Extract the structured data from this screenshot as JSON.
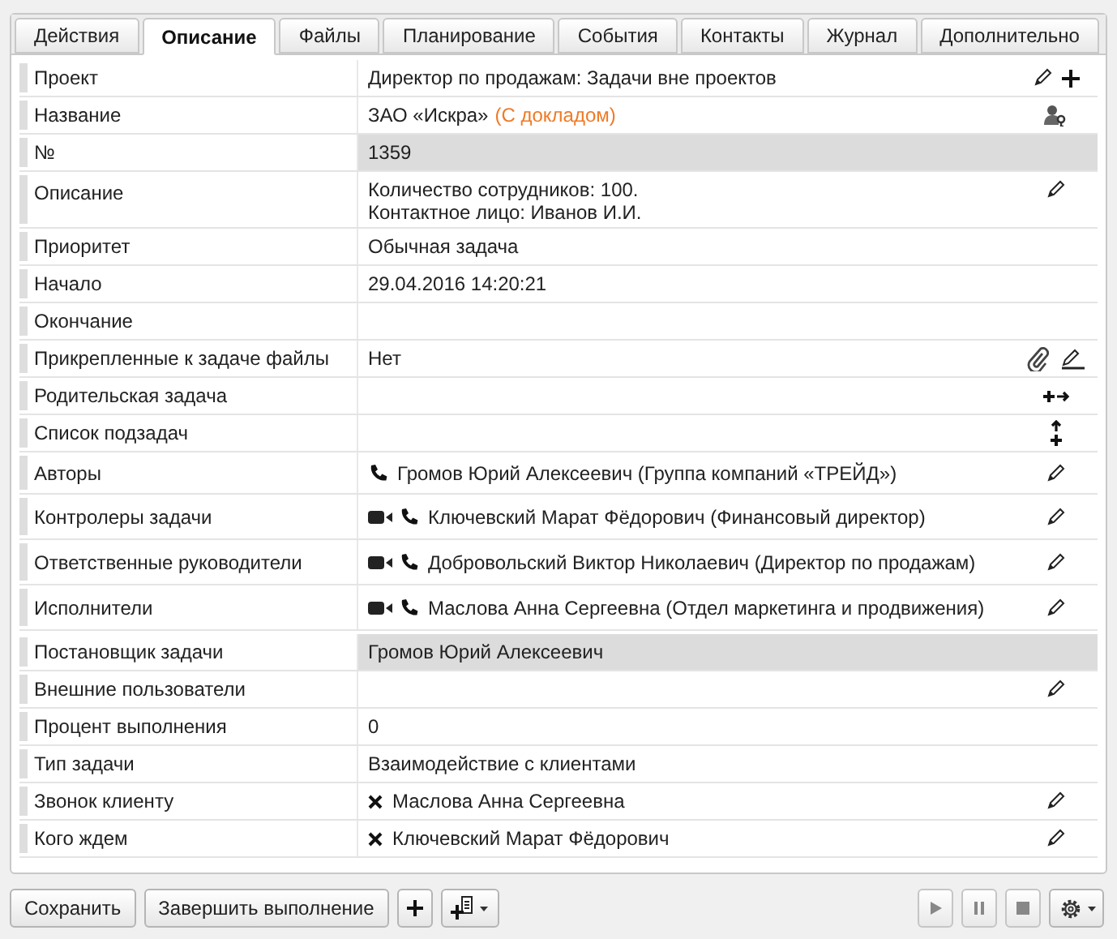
{
  "tabs": [
    {
      "label": "Действия",
      "selected": false
    },
    {
      "label": "Описание",
      "selected": true
    },
    {
      "label": "Файлы",
      "selected": false
    },
    {
      "label": "Планирование",
      "selected": false
    },
    {
      "label": "События",
      "selected": false
    },
    {
      "label": "Контакты",
      "selected": false
    },
    {
      "label": "Журнал",
      "selected": false
    },
    {
      "label": "Дополнительно",
      "selected": false
    }
  ],
  "fields": [
    {
      "label": "Проект",
      "value": "Директор по продажам: Задачи вне проектов",
      "actions": [
        {
          "kind": "edit"
        },
        {
          "kind": "add"
        }
      ]
    },
    {
      "label": "Название",
      "value": "ЗАО «Искра»",
      "note": "(С докладом)",
      "actions": [
        {
          "kind": "user-key"
        }
      ]
    },
    {
      "label": "№",
      "value": "1359",
      "readonly": true
    },
    {
      "label": "Описание",
      "lines": [
        "Количество сотрудников: 100.",
        "Контактное лицо: Иванов И.И."
      ],
      "actions": [
        {
          "kind": "edit"
        }
      ]
    },
    {
      "label": "Приоритет",
      "value": "Обычная задача"
    },
    {
      "label": "Начало",
      "value": "29.04.2016 14:20:21"
    },
    {
      "label": "Окончание"
    },
    {
      "label": "Прикрепленные к задаче файлы",
      "value": "Нет",
      "actions": [
        {
          "kind": "attach"
        },
        {
          "kind": "pencil-line"
        }
      ]
    },
    {
      "label": "Родительская задача",
      "actions": [
        {
          "kind": "link-parent"
        }
      ]
    },
    {
      "label": "Список подзадач",
      "actions": [
        {
          "kind": "add-subtask"
        }
      ]
    },
    {
      "label": "Авторы",
      "people": [
        {
          "name": "Громов Юрий Алексеевич (Группа компаний «ТРЕЙД»)",
          "icons": [
            {
              "kind": "phone"
            }
          ]
        }
      ],
      "actions": [
        {
          "kind": "edit"
        }
      ]
    },
    {
      "label": "Контролеры задачи",
      "people": [
        {
          "name": "Ключевский Марат Фёдорович (Финансовый директор)",
          "icons": [
            {
              "kind": "video"
            },
            {
              "kind": "phone"
            }
          ]
        }
      ],
      "actions": [
        {
          "kind": "edit"
        }
      ]
    },
    {
      "label": "Ответственные руководители",
      "people": [
        {
          "name": "Добровольский Виктор Николаевич (Директор по продажам)",
          "icons": [
            {
              "kind": "video"
            },
            {
              "kind": "phone"
            }
          ]
        }
      ],
      "actions": [
        {
          "kind": "edit"
        }
      ]
    },
    {
      "label": "Исполнители",
      "people": [
        {
          "name": "Маслова Анна Сергеевна (Отдел маркетинга и продвижения)",
          "icons": [
            {
              "kind": "video"
            },
            {
              "kind": "phone"
            }
          ]
        }
      ],
      "actions": [
        {
          "kind": "edit"
        }
      ]
    },
    {
      "label": "Постановщик задачи",
      "value": "Громов Юрий Алексеевич",
      "readonly": true
    },
    {
      "label": "Внешние пользователи",
      "actions": [
        {
          "kind": "edit"
        }
      ]
    },
    {
      "label": "Процент выполнения",
      "value": "0"
    },
    {
      "label": "Тип задачи",
      "value": "Взаимодействие с клиентами"
    },
    {
      "label": "Звонок клиенту",
      "people": [
        {
          "name": "Маслова Анна Сергеевна",
          "icons": [
            {
              "kind": "remove"
            }
          ]
        }
      ],
      "actions": [
        {
          "kind": "edit"
        }
      ]
    },
    {
      "label": "Кого ждем",
      "people": [
        {
          "name": "Ключевский Марат Фёдорович",
          "icons": [
            {
              "kind": "remove"
            }
          ]
        }
      ],
      "actions": [
        {
          "kind": "edit"
        }
      ]
    }
  ],
  "buttons": [
    {
      "label": "Сохранить"
    },
    {
      "label": "Завершить выполнение"
    }
  ]
}
